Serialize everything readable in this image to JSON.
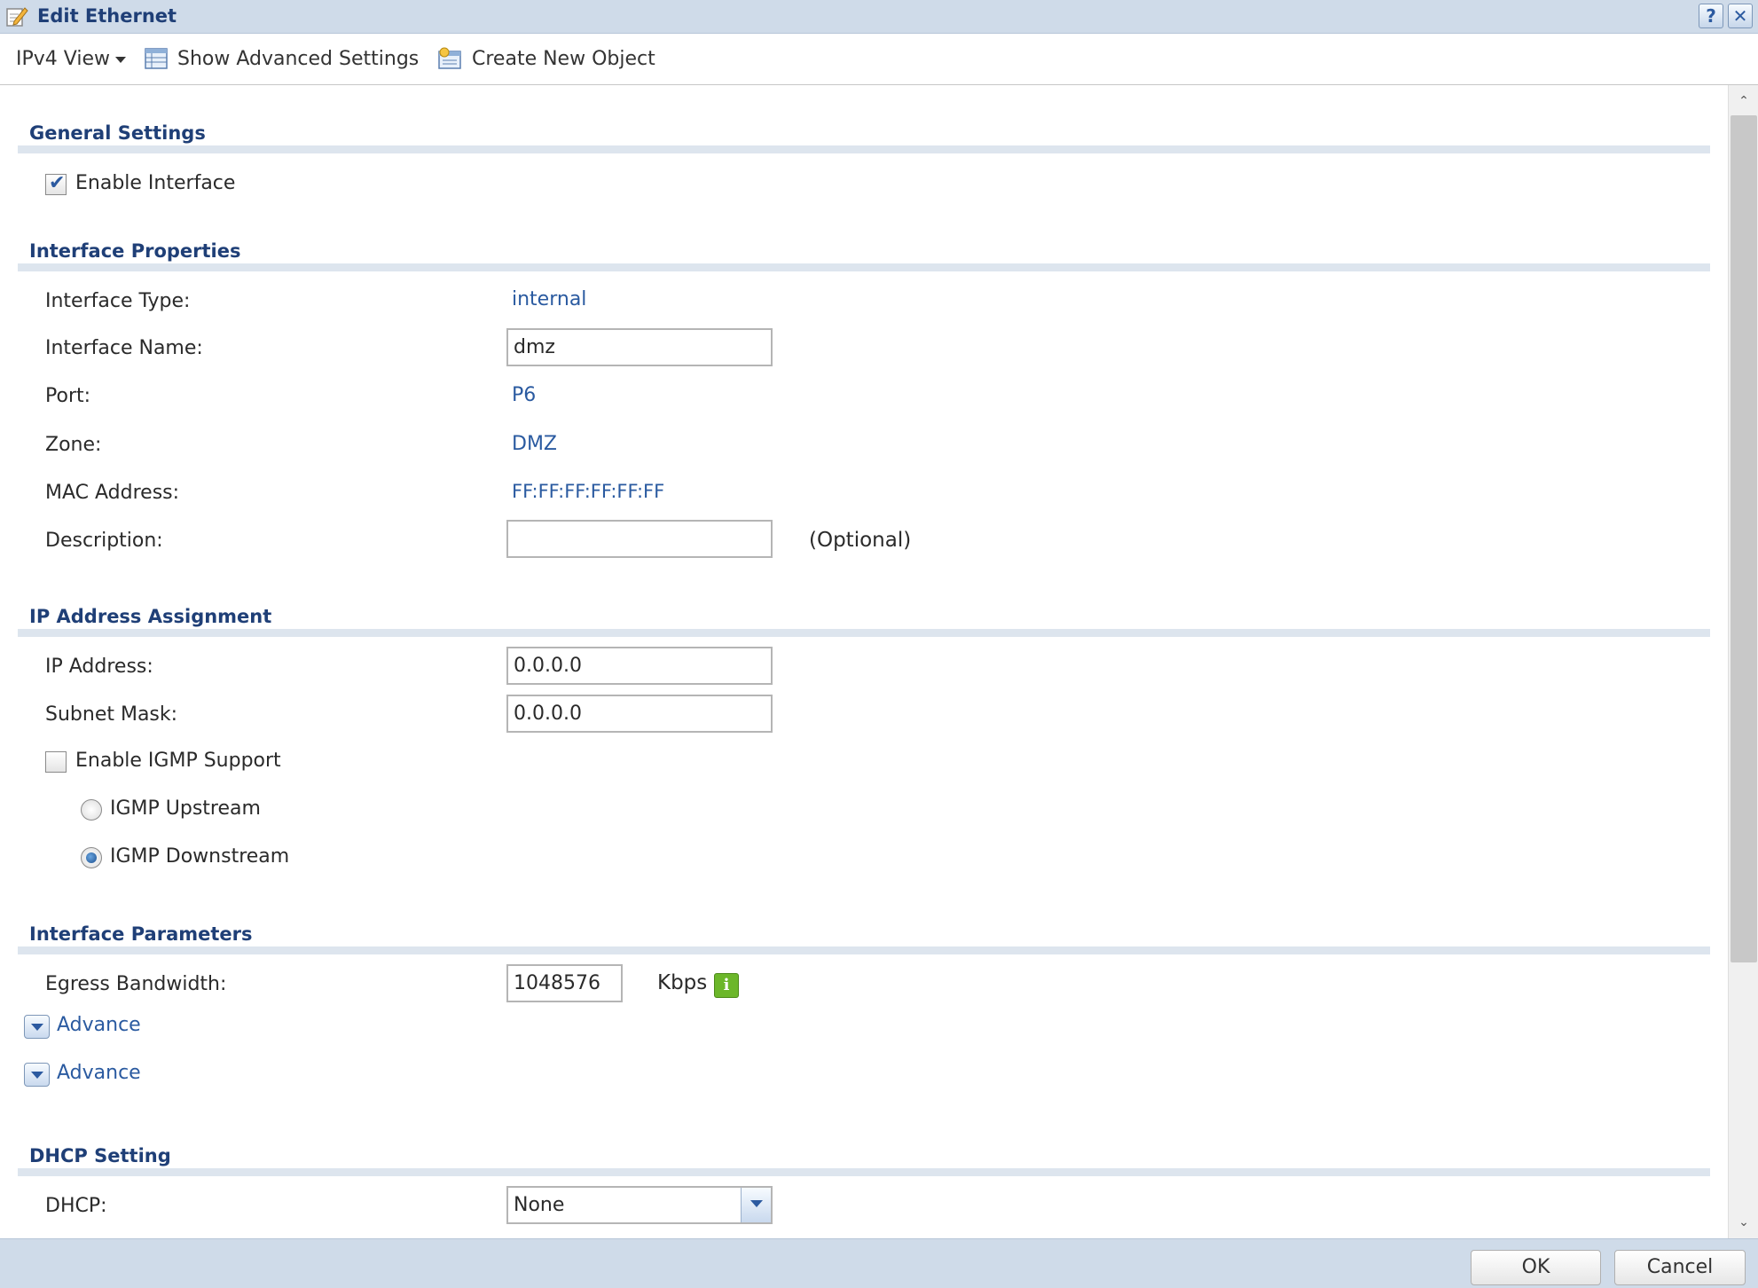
{
  "window": {
    "title": "Edit Ethernet",
    "help_label": "?",
    "close_label": "✕"
  },
  "toolbar": {
    "view_label": "IPv4 View",
    "advanced_label": "Show Advanced Settings",
    "create_label": "Create New Object"
  },
  "general": {
    "title": "General Settings",
    "enable_interface_label": "Enable Interface",
    "enable_interface_checked": true
  },
  "properties": {
    "title": "Interface Properties",
    "type_label": "Interface Type:",
    "type_value": "internal",
    "name_label": "Interface Name:",
    "name_value": "dmz",
    "port_label": "Port:",
    "port_value": "P6",
    "zone_label": "Zone:",
    "zone_value": "DMZ",
    "mac_label": "MAC Address:",
    "mac_value": "FF:FF:FF:FF:FF:FF",
    "description_label": "Description:",
    "description_value": "",
    "optional_note": "(Optional)"
  },
  "ip_assignment": {
    "title": "IP Address Assignment",
    "ip_label": "IP Address:",
    "ip_value": "0.0.0.0",
    "mask_label": "Subnet Mask:",
    "mask_value": "0.0.0.0",
    "igmp_label": "Enable IGMP Support",
    "igmp_checked": false,
    "upstream_label": "IGMP Upstream",
    "downstream_label": "IGMP Downstream",
    "selected_mode": "IGMP Downstream"
  },
  "parameters": {
    "title": "Interface Parameters",
    "egress_label": "Egress Bandwidth:",
    "egress_value": "1048576",
    "unit": "Kbps",
    "info_label": "i",
    "advance_1": "Advance",
    "advance_2": "Advance"
  },
  "dhcp": {
    "title": "DHCP Setting",
    "dhcp_label": "DHCP:",
    "dhcp_value": "None"
  },
  "footer": {
    "ok_label": "OK",
    "cancel_label": "Cancel"
  },
  "icons": {
    "scroll_up": "⌃",
    "scroll_down": "⌄"
  }
}
